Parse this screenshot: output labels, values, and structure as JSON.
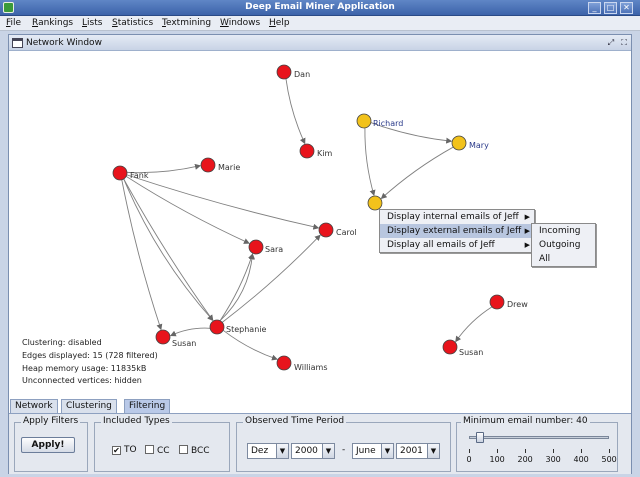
{
  "app": {
    "title": "Deep Email Miner Application"
  },
  "menu": [
    {
      "label": "File",
      "mnemonic": "F",
      "rest": "ile"
    },
    {
      "label": "Rankings",
      "mnemonic": "R",
      "rest": "ankings"
    },
    {
      "label": "Lists",
      "mnemonic": "L",
      "rest": "ists"
    },
    {
      "label": "Statistics",
      "mnemonic": "S",
      "rest": "tatistics"
    },
    {
      "label": "Textmining",
      "mnemonic": "T",
      "rest": "extmining"
    },
    {
      "label": "Windows",
      "mnemonic": "W",
      "rest": "indows"
    },
    {
      "label": "Help",
      "mnemonic": "H",
      "rest": "elp"
    }
  ],
  "network_window": {
    "title": "Network Window"
  },
  "graph": {
    "colors": {
      "node_default": "#e8141c",
      "node_highlight": "#f2c21b",
      "edge": "#808080",
      "label_highlight": "#2a3a8a"
    },
    "nodes": [
      {
        "id": "dan",
        "label": "Dan",
        "highlight": false
      },
      {
        "id": "kim",
        "label": "Kim",
        "highlight": false
      },
      {
        "id": "richard",
        "label": "Richard",
        "highlight": true
      },
      {
        "id": "mary",
        "label": "Mary",
        "highlight": true
      },
      {
        "id": "jeff",
        "label": "",
        "highlight": true
      },
      {
        "id": "frank",
        "label": "Fank",
        "highlight": false
      },
      {
        "id": "marie",
        "label": "Marie",
        "highlight": false
      },
      {
        "id": "carol",
        "label": "Carol",
        "highlight": false
      },
      {
        "id": "sara",
        "label": "Sara",
        "highlight": false
      },
      {
        "id": "stephanie",
        "label": "Stephanie",
        "highlight": false
      },
      {
        "id": "susan1",
        "label": "Susan",
        "highlight": false
      },
      {
        "id": "williams",
        "label": "Williams",
        "highlight": false
      },
      {
        "id": "drew",
        "label": "Drew",
        "highlight": false
      },
      {
        "id": "susan2",
        "label": "Susan",
        "highlight": false
      }
    ],
    "edges": [
      {
        "from": "dan",
        "to": "kim"
      },
      {
        "from": "richard",
        "to": "mary"
      },
      {
        "from": "richard",
        "to": "jeff"
      },
      {
        "from": "mary",
        "to": "jeff"
      },
      {
        "from": "frank",
        "to": "marie"
      },
      {
        "from": "frank",
        "to": "carol"
      },
      {
        "from": "frank",
        "to": "sara"
      },
      {
        "from": "frank",
        "to": "stephanie"
      },
      {
        "from": "frank",
        "to": "stephanie",
        "bend": 1
      },
      {
        "from": "frank",
        "to": "susan1"
      },
      {
        "from": "stephanie",
        "to": "sara"
      },
      {
        "from": "stephanie",
        "to": "sara",
        "bend": 1
      },
      {
        "from": "stephanie",
        "to": "carol"
      },
      {
        "from": "stephanie",
        "to": "susan1"
      },
      {
        "from": "stephanie",
        "to": "williams"
      },
      {
        "from": "drew",
        "to": "susan2"
      }
    ]
  },
  "stats": {
    "clustering": "Clustering: disabled",
    "edges": "Edges displayed: 15 (728 filtered)",
    "heap": "Heap memory usage: 11835kB",
    "unconnected": "Unconnected vertices: hidden"
  },
  "context_menu": {
    "items": [
      {
        "label": "Display internal emails of Jeff",
        "selected": false
      },
      {
        "label": "Display external emails of Jeff",
        "selected": true
      },
      {
        "label": "Display all emails of Jeff",
        "selected": false
      }
    ],
    "submenu": [
      "Incoming",
      "Outgoing",
      "All"
    ]
  },
  "tabs": [
    "Network",
    "Clustering",
    "Filtering"
  ],
  "active_tab": "Filtering",
  "filters": {
    "apply_filters_label": "Apply Filters",
    "apply_button": "Apply!",
    "included_types_label": "Included Types",
    "types": [
      {
        "label": "TO",
        "checked": true
      },
      {
        "label": "CC",
        "checked": false
      },
      {
        "label": "BCC",
        "checked": false
      }
    ],
    "time_period_label": "Observed Time Period",
    "from_month": "Dez",
    "from_year": "2000",
    "separator": "-",
    "to_month": "June",
    "to_year": "2001",
    "min_email_label": "Minimum email number: 40",
    "slider_value": 40,
    "slider_max": 500,
    "slider_ticks": [
      "0",
      "100",
      "200",
      "300",
      "400",
      "500"
    ]
  }
}
